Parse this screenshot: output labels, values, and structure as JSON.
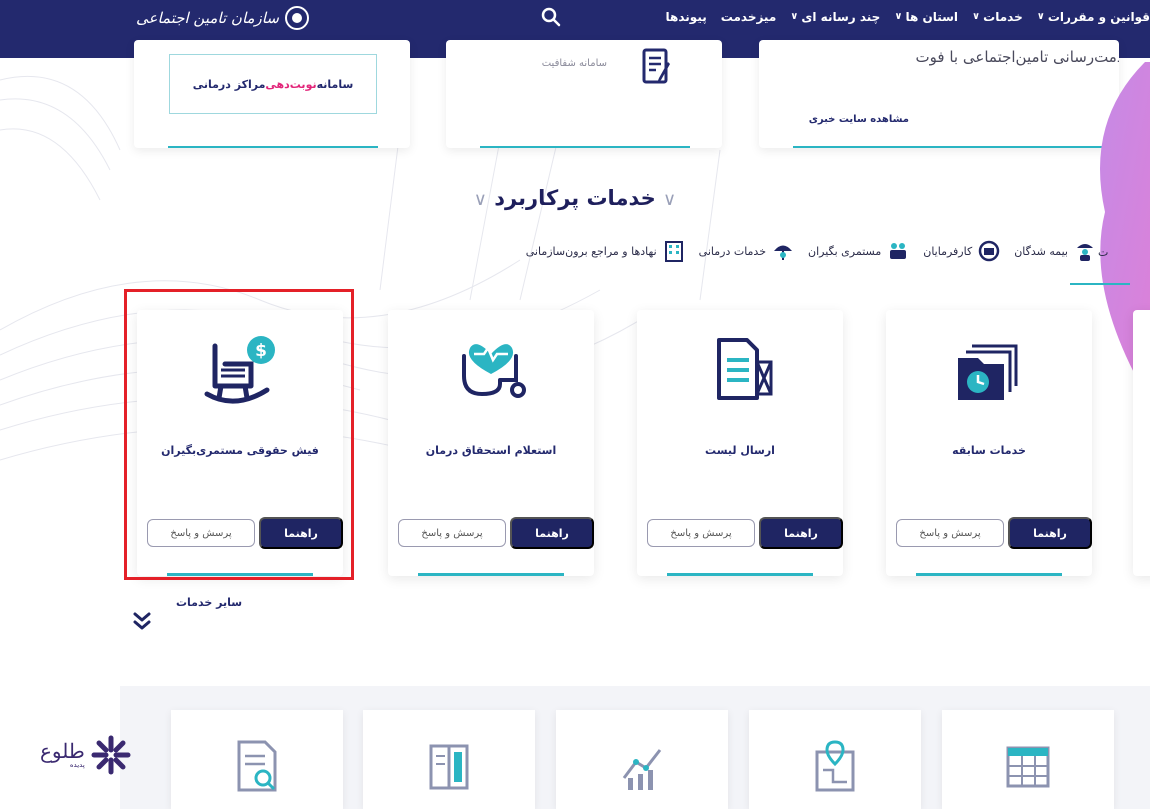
{
  "navbar": {
    "menu": [
      {
        "label": "قوانین و مقررات",
        "chevron": true
      },
      {
        "label": "خدمات",
        "chevron": true
      },
      {
        "label": "استان ها",
        "chevron": true
      },
      {
        "label": "چند رسانه ای",
        "chevron": true
      },
      {
        "label": "میزخدمت",
        "chevron": false
      },
      {
        "label": "پیوندها",
        "chevron": false
      }
    ],
    "search_icon": "search-icon",
    "logo_text": "سازمان تامین اجتماعی"
  },
  "top_cards": {
    "appointment": {
      "part1": "سامانه",
      "part2": "نوبت‌دهی",
      "part3": "مراکز درمانی"
    },
    "transparency": {
      "label": "سامانه شفافیت"
    },
    "news": {
      "title": "خدمت‌رسانی تامین‌اجتماعی با فوت",
      "link": "مشاهده سایت خبری"
    }
  },
  "section": {
    "title": "خدمات پرکاربرد"
  },
  "category_tabs": [
    {
      "label": "ت",
      "icon": "text-cut"
    },
    {
      "label": "بیمه شدگان",
      "icon": "insured-person-icon"
    },
    {
      "label": "کارفرمایان",
      "icon": "employer-icon"
    },
    {
      "label": "مستمری بگیران",
      "icon": "pensioner-icon"
    },
    {
      "label": "خدمات درمانی",
      "icon": "medical-umbrella-icon"
    },
    {
      "label": "نهادها و مراجع برون‌سازمانی",
      "icon": "building-icon"
    }
  ],
  "services": [
    {
      "title": "فیش حقوقی مستمری‌بگیران",
      "icon": "rocking-chair-dollar-icon",
      "guide_label": "راهنما",
      "faq_label": "پرسش و پاسخ",
      "highlighted": true
    },
    {
      "title": "استعلام استحقاق درمان",
      "icon": "stethoscope-heart-icon",
      "guide_label": "راهنما",
      "faq_label": "پرسش و پاسخ",
      "highlighted": false
    },
    {
      "title": "ارسال لیست",
      "icon": "document-envelope-icon",
      "guide_label": "راهنما",
      "faq_label": "پرسش و پاسخ",
      "highlighted": false
    },
    {
      "title": "خدمات سابقه",
      "icon": "folder-clock-icon",
      "guide_label": "راهنما",
      "faq_label": "پرسش و پاسخ",
      "highlighted": false
    }
  ],
  "other_services": {
    "label": "سایر خدمات"
  },
  "bottom_icons": [
    "document-search-icon",
    "book-icon",
    "chart-growth-icon",
    "map-pin-icon",
    "calendar-table-icon"
  ],
  "watermark": {
    "main": "طلوع",
    "sub": "پدیده"
  },
  "colors": {
    "navy": "#23296e",
    "teal": "#2bb5c3",
    "highlight_red": "#e42028",
    "pink": "#e2267a"
  }
}
